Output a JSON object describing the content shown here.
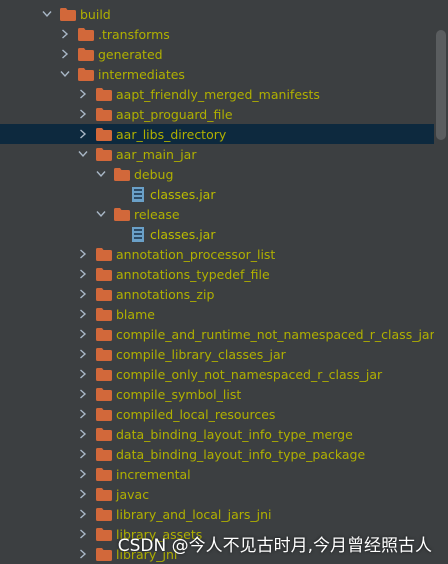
{
  "colors": {
    "background": "#3c3f41",
    "selected_row": "#0d293e",
    "label": "#b0b000",
    "folder": "#d2683a",
    "file_icon": "#6aa0c8"
  },
  "tree": [
    {
      "label": "build",
      "depth": 0,
      "expanded": true,
      "type": "folder"
    },
    {
      "label": ".transforms",
      "depth": 1,
      "expanded": false,
      "type": "folder"
    },
    {
      "label": "generated",
      "depth": 1,
      "expanded": false,
      "type": "folder"
    },
    {
      "label": "intermediates",
      "depth": 1,
      "expanded": true,
      "type": "folder"
    },
    {
      "label": "aapt_friendly_merged_manifests",
      "depth": 2,
      "expanded": false,
      "type": "folder"
    },
    {
      "label": "aapt_proguard_file",
      "depth": 2,
      "expanded": false,
      "type": "folder"
    },
    {
      "label": "aar_libs_directory",
      "depth": 2,
      "expanded": false,
      "type": "folder",
      "selected": true
    },
    {
      "label": "aar_main_jar",
      "depth": 2,
      "expanded": true,
      "type": "folder"
    },
    {
      "label": "debug",
      "depth": 3,
      "expanded": true,
      "type": "folder"
    },
    {
      "label": "classes.jar",
      "depth": 4,
      "type": "file"
    },
    {
      "label": "release",
      "depth": 3,
      "expanded": true,
      "type": "folder"
    },
    {
      "label": "classes.jar",
      "depth": 4,
      "type": "file"
    },
    {
      "label": "annotation_processor_list",
      "depth": 2,
      "expanded": false,
      "type": "folder"
    },
    {
      "label": "annotations_typedef_file",
      "depth": 2,
      "expanded": false,
      "type": "folder"
    },
    {
      "label": "annotations_zip",
      "depth": 2,
      "expanded": false,
      "type": "folder"
    },
    {
      "label": "blame",
      "depth": 2,
      "expanded": false,
      "type": "folder"
    },
    {
      "label": "compile_and_runtime_not_namespaced_r_class_jar",
      "depth": 2,
      "expanded": false,
      "type": "folder"
    },
    {
      "label": "compile_library_classes_jar",
      "depth": 2,
      "expanded": false,
      "type": "folder"
    },
    {
      "label": "compile_only_not_namespaced_r_class_jar",
      "depth": 2,
      "expanded": false,
      "type": "folder"
    },
    {
      "label": "compile_symbol_list",
      "depth": 2,
      "expanded": false,
      "type": "folder"
    },
    {
      "label": "compiled_local_resources",
      "depth": 2,
      "expanded": false,
      "type": "folder"
    },
    {
      "label": "data_binding_layout_info_type_merge",
      "depth": 2,
      "expanded": false,
      "type": "folder"
    },
    {
      "label": "data_binding_layout_info_type_package",
      "depth": 2,
      "expanded": false,
      "type": "folder"
    },
    {
      "label": "incremental",
      "depth": 2,
      "expanded": false,
      "type": "folder"
    },
    {
      "label": "javac",
      "depth": 2,
      "expanded": false,
      "type": "folder"
    },
    {
      "label": "library_and_local_jars_jni",
      "depth": 2,
      "expanded": false,
      "type": "folder"
    },
    {
      "label": "library_assets",
      "depth": 2,
      "expanded": false,
      "type": "folder"
    },
    {
      "label": "library_jni",
      "depth": 2,
      "expanded": false,
      "type": "folder"
    }
  ],
  "watermark": "CSDN @今人不见古时月,今月曾经照古人"
}
